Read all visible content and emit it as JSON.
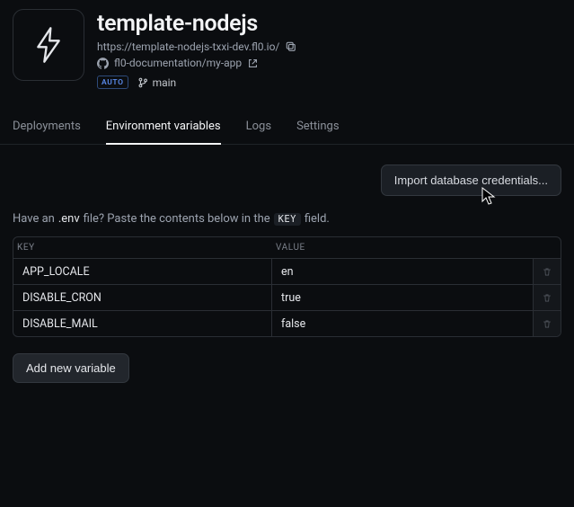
{
  "header": {
    "title": "template-nodejs",
    "url": "https://template-nodejs-txxi-dev.fl0.io/",
    "repo": "fl0-documentation/my-app",
    "auto_badge": "AUTO",
    "branch": "main"
  },
  "tabs": [
    {
      "label": "Deployments",
      "active": false
    },
    {
      "label": "Environment variables",
      "active": true
    },
    {
      "label": "Logs",
      "active": false
    },
    {
      "label": "Settings",
      "active": false
    }
  ],
  "import_button": "Import database credentials...",
  "hint": {
    "pre": "Have an",
    "env": ".env",
    "mid": "file? Paste the contents below in the",
    "key_chip": "KEY",
    "post": "field."
  },
  "table": {
    "head_key": "KEY",
    "head_value": "VALUE",
    "rows": [
      {
        "key": "APP_LOCALE",
        "value": "en"
      },
      {
        "key": "DISABLE_CRON",
        "value": "true"
      },
      {
        "key": "DISABLE_MAIL",
        "value": "false"
      }
    ]
  },
  "add_button": "Add new variable"
}
